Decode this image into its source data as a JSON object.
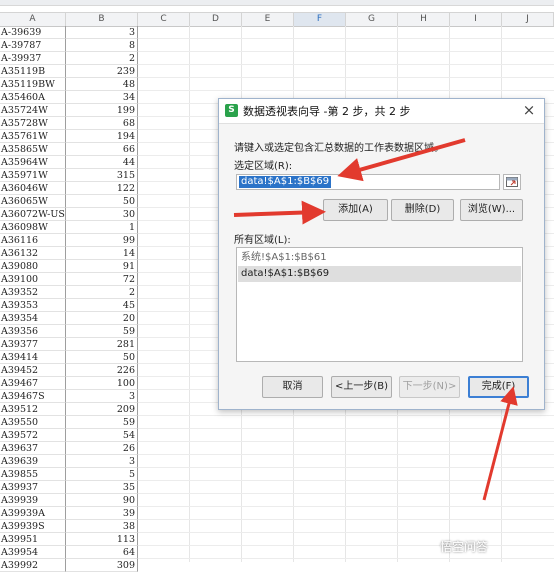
{
  "columns": [
    "A",
    "B",
    "C",
    "D",
    "E",
    "F",
    "G",
    "H",
    "I",
    "J"
  ],
  "active_column": "F",
  "rows": [
    [
      "A-39639",
      "3"
    ],
    [
      "A-39787",
      "8"
    ],
    [
      "A-39937",
      "2"
    ],
    [
      "A35119B",
      "239"
    ],
    [
      "A35119BW",
      "48"
    ],
    [
      "A35460A",
      "34"
    ],
    [
      "A35724W",
      "199"
    ],
    [
      "A35728W",
      "68"
    ],
    [
      "A35761W",
      "194"
    ],
    [
      "A35865W",
      "66"
    ],
    [
      "A35964W",
      "44"
    ],
    [
      "A35971W",
      "315"
    ],
    [
      "A36046W",
      "122"
    ],
    [
      "A36065W",
      "50"
    ],
    [
      "A36072W-US",
      "30"
    ],
    [
      "A36098W",
      "1"
    ],
    [
      "A36116",
      "99"
    ],
    [
      "A36132",
      "14"
    ],
    [
      "A39080",
      "91"
    ],
    [
      "A39100",
      "72"
    ],
    [
      "A39352",
      "2"
    ],
    [
      "A39353",
      "45"
    ],
    [
      "A39354",
      "20"
    ],
    [
      "A39356",
      "59"
    ],
    [
      "A39377",
      "281"
    ],
    [
      "A39414",
      "50"
    ],
    [
      "A39452",
      "226"
    ],
    [
      "A39467",
      "100"
    ],
    [
      "A39467S",
      "3"
    ],
    [
      "A39512",
      "209"
    ],
    [
      "A39550",
      "59"
    ],
    [
      "A39572",
      "54"
    ],
    [
      "A39637",
      "26"
    ],
    [
      "A39639",
      "3"
    ],
    [
      "A39855",
      "5"
    ],
    [
      "A39937",
      "35"
    ],
    [
      "A39939",
      "90"
    ],
    [
      "A39939A",
      "39"
    ],
    [
      "A39939S",
      "38"
    ],
    [
      "A39951",
      "113"
    ],
    [
      "A39954",
      "64"
    ],
    [
      "A39992",
      "309"
    ]
  ],
  "dialog": {
    "app_icon": "S",
    "title": "数据透视表向导 -第 2 步，共 2 步",
    "close": "×",
    "prompt": "请键入或选定包含汇总数据的工作表数据区域。",
    "range_label": "选定区域(R):",
    "range_value": "data!$A$1:$B$69",
    "buttons": {
      "add": "添加(A)",
      "delete": "删除(D)",
      "browse": "浏览(W)..."
    },
    "all_ranges_label": "所有区域(L):",
    "all_ranges": [
      "系统!$A$1:$B$61",
      "data!$A$1:$B$69"
    ],
    "footer": {
      "cancel": "取消",
      "back": "<上一步(B)",
      "next": "下一步(N)>",
      "finish": "完成(F)"
    }
  },
  "watermark": "悟空问答",
  "colors": {
    "accent": "#2b73c8",
    "arrow": "#e23a2e",
    "excel_green": "#2aa24b"
  }
}
